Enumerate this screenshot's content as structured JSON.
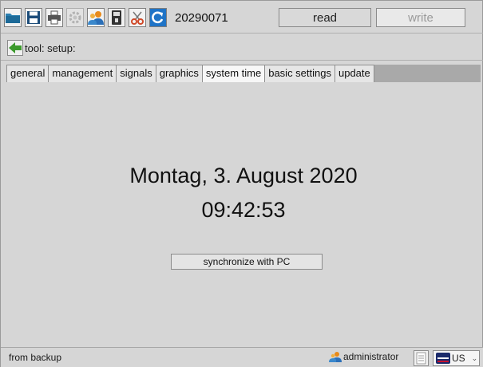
{
  "toolbar": {
    "serial": "20290071",
    "read_label": "read",
    "write_label": "write"
  },
  "breadcrumb": {
    "label": "tool: setup:"
  },
  "tabs": [
    {
      "label": "general"
    },
    {
      "label": "management"
    },
    {
      "label": "signals"
    },
    {
      "label": "graphics"
    },
    {
      "label": "system time"
    },
    {
      "label": "basic settings"
    },
    {
      "label": "update"
    }
  ],
  "active_tab": "system time",
  "main": {
    "date": "Montag, 3. August 2020",
    "time": "09:42:53",
    "sync_label": "synchronize with PC"
  },
  "statusbar": {
    "left_text": "from backup",
    "user": "administrator",
    "language": "US"
  },
  "colors": {
    "folder": "#2b7fb0",
    "back_arrow": "#3c9a2c",
    "refresh": "#1f74c7",
    "cut": "#d04a2a"
  }
}
